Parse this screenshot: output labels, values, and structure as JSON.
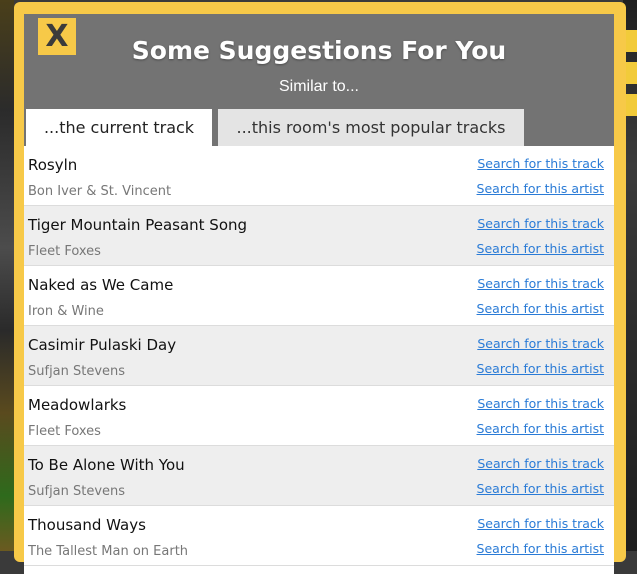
{
  "dialog": {
    "close_label": "X",
    "title": "Some Suggestions For You",
    "subtitle": "Similar to..."
  },
  "tabs": [
    {
      "label": "...the current track",
      "active": true
    },
    {
      "label": "...this room's most popular tracks",
      "active": false
    }
  ],
  "links": {
    "search_track": "Search for this track",
    "search_artist": "Search for this artist"
  },
  "suggestions": [
    {
      "track": "Rosyln",
      "artist": "Bon Iver & St. Vincent"
    },
    {
      "track": "Tiger Mountain Peasant Song",
      "artist": "Fleet Foxes"
    },
    {
      "track": "Naked as We Came",
      "artist": "Iron & Wine"
    },
    {
      "track": "Casimir Pulaski Day",
      "artist": "Sufjan Stevens"
    },
    {
      "track": "Meadowlarks",
      "artist": "Fleet Foxes"
    },
    {
      "track": "To Be Alone With You",
      "artist": "Sufjan Stevens"
    },
    {
      "track": "Thousand Ways",
      "artist": "The Tallest Man on Earth"
    }
  ],
  "colors": {
    "frame": "#f7c948",
    "header": "#737373",
    "link": "#2a7bd6"
  }
}
